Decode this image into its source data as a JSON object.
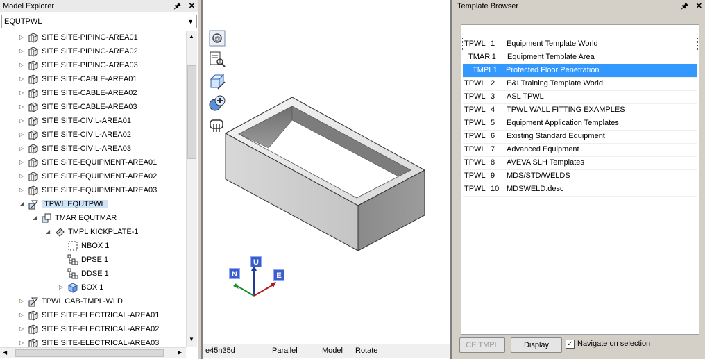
{
  "model_explorer": {
    "title": "Model Explorer",
    "pin_icon": "pin-icon",
    "close_icon": "close-icon",
    "combo_value": "EQUTPWL",
    "tree": [
      {
        "label": "SITE SITE-PIPING-AREA01",
        "icon": "site-icon",
        "depth": 0,
        "expander": "collapsed"
      },
      {
        "label": "SITE SITE-PIPING-AREA02",
        "icon": "site-icon",
        "depth": 0,
        "expander": "collapsed"
      },
      {
        "label": "SITE SITE-PIPING-AREA03",
        "icon": "site-icon",
        "depth": 0,
        "expander": "collapsed"
      },
      {
        "label": "SITE SITE-CABLE-AREA01",
        "icon": "site-icon",
        "depth": 0,
        "expander": "collapsed"
      },
      {
        "label": "SITE SITE-CABLE-AREA02",
        "icon": "site-icon",
        "depth": 0,
        "expander": "collapsed"
      },
      {
        "label": "SITE SITE-CABLE-AREA03",
        "icon": "site-icon",
        "depth": 0,
        "expander": "collapsed"
      },
      {
        "label": "SITE SITE-CIVIL-AREA01",
        "icon": "site-icon",
        "depth": 0,
        "expander": "collapsed"
      },
      {
        "label": "SITE SITE-CIVIL-AREA02",
        "icon": "site-icon",
        "depth": 0,
        "expander": "collapsed"
      },
      {
        "label": "SITE SITE-CIVIL-AREA03",
        "icon": "site-icon",
        "depth": 0,
        "expander": "collapsed"
      },
      {
        "label": "SITE SITE-EQUIPMENT-AREA01",
        "icon": "site-icon",
        "depth": 0,
        "expander": "collapsed"
      },
      {
        "label": "SITE SITE-EQUIPMENT-AREA02",
        "icon": "site-icon",
        "depth": 0,
        "expander": "collapsed"
      },
      {
        "label": "SITE SITE-EQUIPMENT-AREA03",
        "icon": "site-icon",
        "depth": 0,
        "expander": "collapsed"
      },
      {
        "label": "TPWL EQUTPWL",
        "icon": "template-world-icon",
        "depth": 0,
        "expander": "expanded",
        "selected": true
      },
      {
        "label": "TMAR EQUTMAR",
        "icon": "template-area-icon",
        "depth": 1,
        "expander": "expanded"
      },
      {
        "label": "TMPL KICKPLATE-1",
        "icon": "template-icon",
        "depth": 2,
        "expander": "expanded"
      },
      {
        "label": "NBOX 1",
        "icon": "negative-box-icon",
        "depth": 3,
        "expander": "none"
      },
      {
        "label": "DPSE 1",
        "icon": "hierarchy-icon",
        "depth": 3,
        "expander": "none"
      },
      {
        "label": "DDSE 1",
        "icon": "hierarchy-icon",
        "depth": 3,
        "expander": "none"
      },
      {
        "label": "BOX 1",
        "icon": "box-icon",
        "depth": 3,
        "expander": "collapsed"
      },
      {
        "label": "TPWL CAB-TMPL-WLD",
        "icon": "template-world-icon",
        "depth": 0,
        "expander": "collapsed"
      },
      {
        "label": "SITE SITE-ELECTRICAL-AREA01",
        "icon": "site-icon",
        "depth": 0,
        "expander": "collapsed"
      },
      {
        "label": "SITE SITE-ELECTRICAL-AREA02",
        "icon": "site-icon",
        "depth": 0,
        "expander": "collapsed"
      },
      {
        "label": "SITE SITE-ELECTRICAL-AREA03",
        "icon": "site-icon",
        "depth": 0,
        "expander": "collapsed"
      }
    ]
  },
  "view3d": {
    "tools": [
      "view-direction-icon",
      "zoom-selection-icon",
      "box-edit-icon",
      "clipping-icon",
      "walk-icon"
    ],
    "axes": {
      "north": "N",
      "up": "U",
      "east": "E"
    },
    "status": {
      "direction": "e45n35d",
      "projection": "Parallel",
      "mode": "Model",
      "action": "Rotate"
    }
  },
  "template_browser": {
    "title": "Template Browser",
    "pin_icon": "pin-icon",
    "close_icon": "close-icon",
    "rows": [
      {
        "type": "TPWL",
        "num": "1",
        "desc": "Equipment Template World",
        "focus": true
      },
      {
        "type": "TMAR",
        "num": "1",
        "desc": "Equipment Template Area"
      },
      {
        "type": "TMPL",
        "num": "1",
        "desc": "Protected Floor Penetration",
        "selected": true
      },
      {
        "type": "TPWL",
        "num": "2",
        "desc": "E&I Training Template World"
      },
      {
        "type": "TPWL",
        "num": "3",
        "desc": "ASL TPWL"
      },
      {
        "type": "TPWL",
        "num": "4",
        "desc": " TPWL WALL FITTING EXAMPLES"
      },
      {
        "type": "TPWL",
        "num": "5",
        "desc": "Equipment Application Templates"
      },
      {
        "type": "TPWL",
        "num": "6",
        "desc": "Existing Standard Equipment"
      },
      {
        "type": "TPWL",
        "num": "7",
        "desc": "Advanced Equipment"
      },
      {
        "type": "TPWL",
        "num": "8",
        "desc": "AVEVA SLH Templates"
      },
      {
        "type": "TPWL",
        "num": "9",
        "desc": "MDS/STD/WELDS"
      },
      {
        "type": "TPWL",
        "num": "10",
        "desc": " MDSWELD.desc"
      }
    ],
    "ce_tmpl_label": "CE TMPL",
    "display_label": "Display",
    "navigate_label": "Navigate on selection",
    "navigate_checked": true
  },
  "colors": {
    "selection": "#3399ff",
    "tree_selection": "#cfe3f7",
    "axis_label_bg": "#3d5ec9"
  }
}
